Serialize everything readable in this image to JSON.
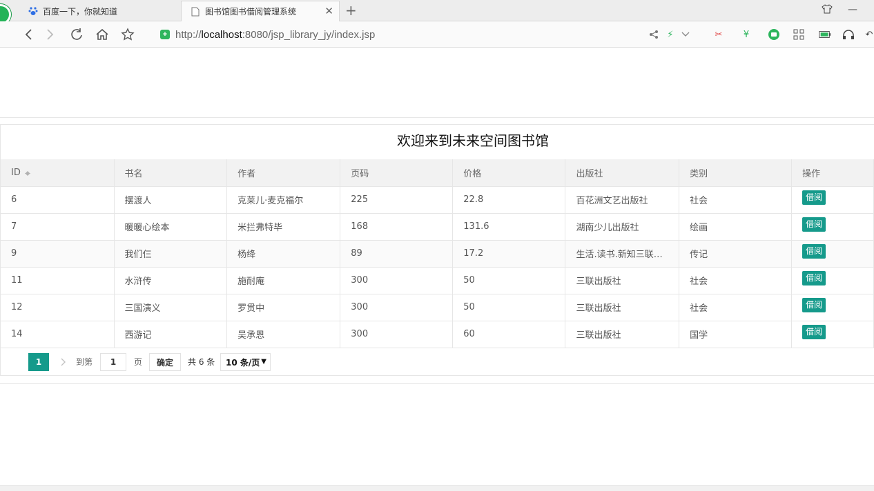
{
  "browser": {
    "tabs": [
      {
        "label": "百度一下，你就知道",
        "icon": "baidu-paw-icon"
      },
      {
        "label": "图书馆图书借阅管理系统",
        "icon": "page-icon"
      }
    ],
    "address": {
      "scheme": "http://",
      "host": "localhost",
      "path": ":8080/jsp_library_jy/index.jsp"
    }
  },
  "page": {
    "caption": "欢迎来到未来空间图书馆",
    "columns": [
      "ID",
      "书名",
      "作者",
      "页码",
      "价格",
      "出版社",
      "类别",
      "操作"
    ],
    "rows": [
      {
        "id": "6",
        "name": "摆渡人",
        "author": "克莱儿·麦克福尔",
        "pages": "225",
        "price": "22.8",
        "publisher": "百花洲文艺出版社",
        "category": "社会",
        "action": "借阅"
      },
      {
        "id": "7",
        "name": "暖暖心绘本",
        "author": "米拦弗特毕",
        "pages": "168",
        "price": "131.6",
        "publisher": "湖南少儿出版社",
        "category": "绘画",
        "action": "借阅"
      },
      {
        "id": "9",
        "name": "我们仨",
        "author": "杨绛",
        "pages": "89",
        "price": "17.2",
        "publisher": "生活.读书.新知三联…",
        "category": "传记",
        "action": "借阅"
      },
      {
        "id": "11",
        "name": "水浒传",
        "author": "施耐庵",
        "pages": "300",
        "price": "50",
        "publisher": "三联出版社",
        "category": "社会",
        "action": "借阅"
      },
      {
        "id": "12",
        "name": "三国演义",
        "author": "罗贯中",
        "pages": "300",
        "price": "50",
        "publisher": "三联出版社",
        "category": "社会",
        "action": "借阅"
      },
      {
        "id": "14",
        "name": "西游记",
        "author": "吴承恩",
        "pages": "300",
        "price": "60",
        "publisher": "三联出版社",
        "category": "国学",
        "action": "借阅"
      }
    ],
    "pager": {
      "current": "1",
      "goto_label": "到第",
      "goto_value": "1",
      "unit": "页",
      "confirm": "确定",
      "total": "共 6 条",
      "page_size": "10 条/页"
    }
  },
  "colors": {
    "accent": "#159a8b",
    "header_bg": "#f2f2f2",
    "border": "#e6e6e6"
  }
}
